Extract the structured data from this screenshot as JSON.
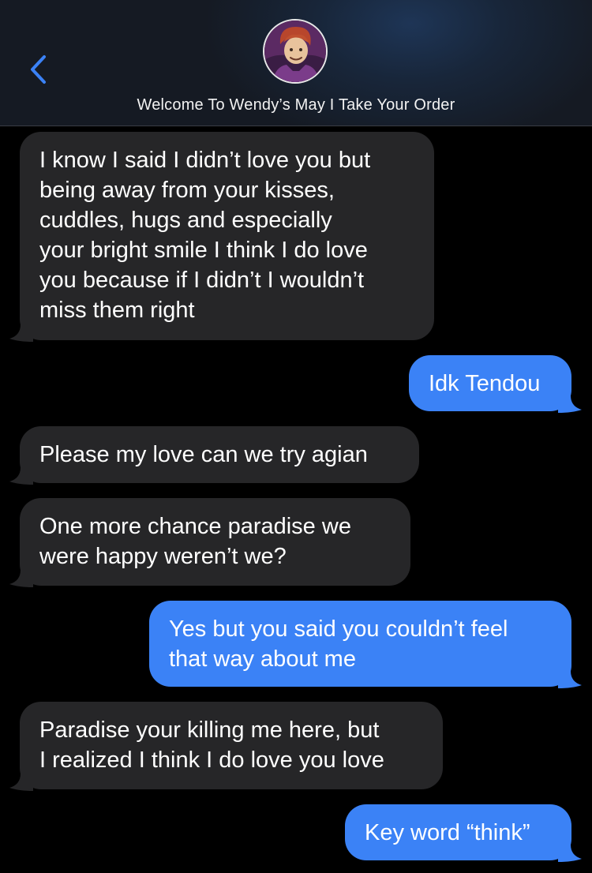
{
  "header": {
    "contact_name": "Welcome To Wendy’s May I Take Your Order",
    "back_icon": "chevron-left-icon",
    "accent_color": "#3b82f6"
  },
  "messages": [
    {
      "direction": "incoming",
      "lines": [
        "I know I said I didn’t love you but",
        "being away from your kisses,",
        "cuddles, hugs and especially",
        "your bright smile I think I do love",
        "you because if I didn’t I wouldn’t",
        "miss them right"
      ]
    },
    {
      "direction": "outgoing",
      "lines": [
        "Idk Tendou"
      ]
    },
    {
      "direction": "incoming",
      "lines": [
        "Please my love can we try agian"
      ]
    },
    {
      "direction": "incoming",
      "lines": [
        "One more chance paradise we",
        "were happy weren’t we?"
      ]
    },
    {
      "direction": "outgoing",
      "lines": [
        "Yes but you said you couldn’t feel",
        "that way about me"
      ]
    },
    {
      "direction": "incoming",
      "lines": [
        "Paradise your killing me here, but",
        "I realized I think I do love you love"
      ]
    },
    {
      "direction": "outgoing",
      "lines": [
        "Key word “think”"
      ]
    }
  ],
  "colors": {
    "incoming_bubble": "#262628",
    "outgoing_bubble": "#3b82f6",
    "background": "#000000"
  }
}
